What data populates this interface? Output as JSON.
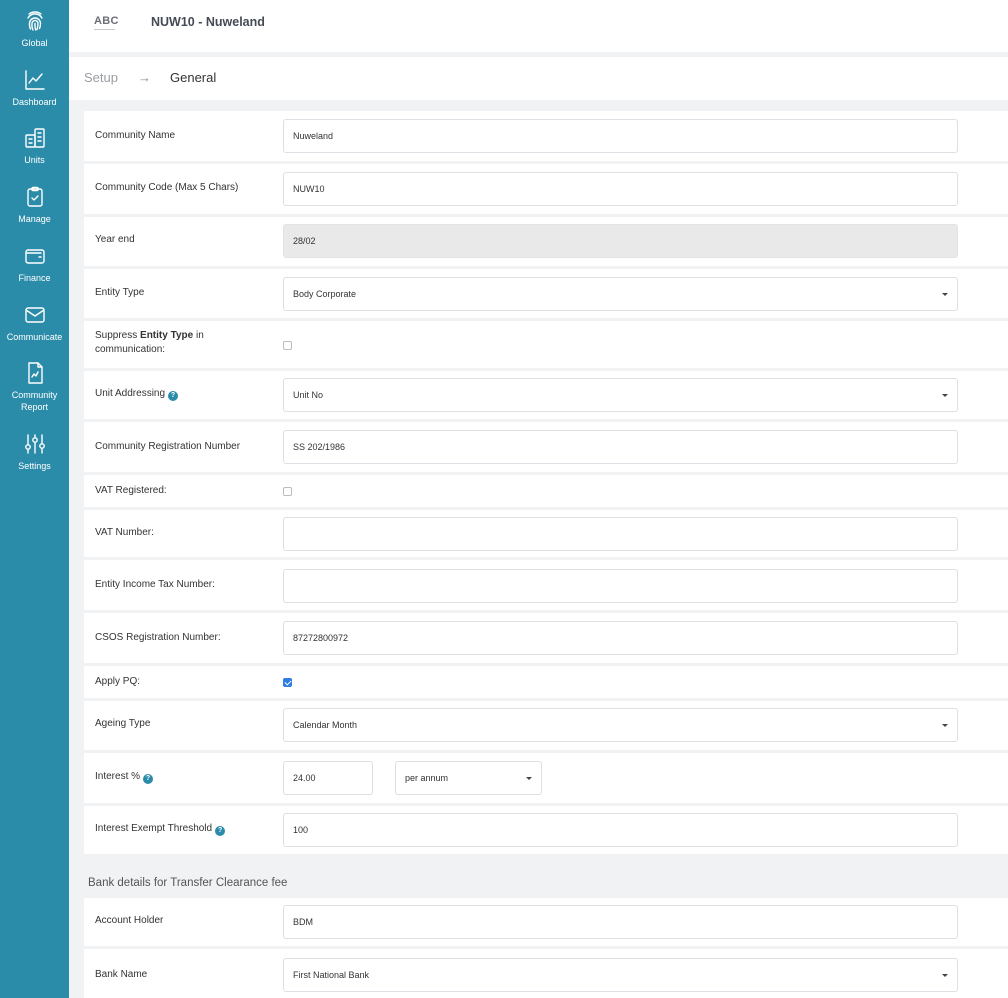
{
  "nav": [
    {
      "label": "Global",
      "icon": "fingerprint-icon"
    },
    {
      "label": "Dashboard",
      "icon": "line-chart-icon"
    },
    {
      "label": "Units",
      "icon": "buildings-icon"
    },
    {
      "label": "Manage",
      "icon": "clipboard-check-icon"
    },
    {
      "label": "Finance",
      "icon": "wallet-icon"
    },
    {
      "label": "Communicate",
      "icon": "envelope-icon"
    },
    {
      "label": "Community Report",
      "icon": "report-document-icon"
    },
    {
      "label": "Settings",
      "icon": "sliders-icon"
    }
  ],
  "header": {
    "logo": "ABC",
    "title": "NUW10 - Nuweland"
  },
  "breadcrumb": {
    "setup": "Setup",
    "arrow": "→",
    "current": "General"
  },
  "form": {
    "community_name": {
      "label": "Community Name",
      "value": "Nuweland"
    },
    "community_code": {
      "label": "Community Code (Max 5 Chars)",
      "value": "NUW10"
    },
    "year_end": {
      "label": "Year end",
      "value": "28/02"
    },
    "entity_type": {
      "label": "Entity Type",
      "value": "Body Corporate"
    },
    "suppress_entity": {
      "label_prefix": "Suppress ",
      "label_bold": "Entity Type",
      "label_suffix": " in communication:",
      "checked": false
    },
    "unit_addressing": {
      "label": "Unit Addressing",
      "value": "Unit No"
    },
    "registration_number": {
      "label": "Community Registration Number",
      "value": "SS 202/1986"
    },
    "vat_registered": {
      "label": "VAT Registered:",
      "checked": false
    },
    "vat_number": {
      "label": "VAT Number:",
      "value": ""
    },
    "income_tax_number": {
      "label": "Entity Income Tax Number:",
      "value": ""
    },
    "csos_number": {
      "label": "CSOS Registration Number:",
      "value": "87272800972"
    },
    "apply_pq": {
      "label": "Apply PQ:",
      "checked": true
    },
    "ageing_type": {
      "label": "Ageing Type",
      "value": "Calendar Month"
    },
    "interest": {
      "label": "Interest %",
      "value": "24.00",
      "period": "per annum"
    },
    "interest_exempt": {
      "label": "Interest Exempt Threshold",
      "value": "100"
    }
  },
  "bank_section": {
    "title": "Bank details for Transfer Clearance fee",
    "account_holder": {
      "label": "Account Holder",
      "value": "BDM"
    },
    "bank_name": {
      "label": "Bank Name",
      "value": "First National Bank"
    }
  },
  "help_symbol": "?"
}
